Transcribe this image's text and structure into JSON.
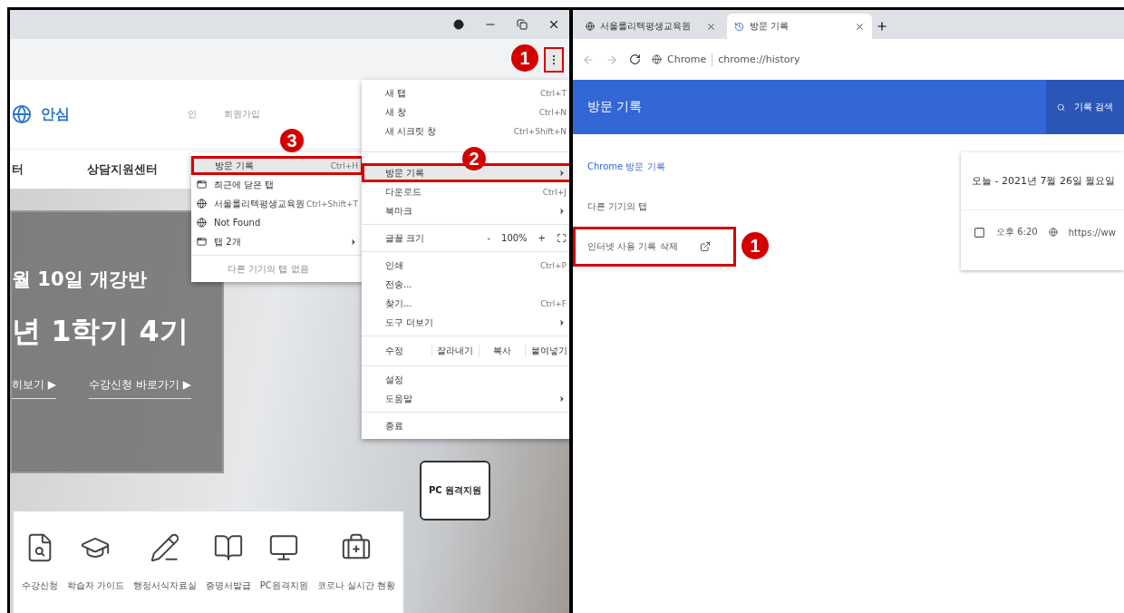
{
  "left_window": {
    "menu_badge": "1",
    "site": {
      "logo_text": "안심",
      "header_links": [
        "인",
        "회원가입"
      ],
      "nav": [
        "터",
        "상담지원센터"
      ],
      "hero": {
        "subtitle": "월 10일 개강반",
        "title": "년 1학기 4기",
        "links": [
          "히보기 ▶",
          "수강신청 바로가기 ▶"
        ]
      },
      "floating_card": "PC 원격지원",
      "quick_menu": [
        {
          "label": "수강신청",
          "kind": "apply"
        },
        {
          "label": "학습자 가이드",
          "kind": "guide"
        },
        {
          "label": "행정서식자료실",
          "kind": "forms"
        },
        {
          "label": "증명서발급",
          "kind": "certificate"
        },
        {
          "label": "PC원격지원",
          "kind": "remote"
        },
        {
          "label": "코로나 실시간 현황",
          "kind": "covid"
        }
      ]
    },
    "main_menu": [
      {
        "kind": "item",
        "label": "새 탭",
        "shortcut": "Ctrl+T"
      },
      {
        "kind": "item",
        "label": "새 창",
        "shortcut": "Ctrl+N"
      },
      {
        "kind": "item",
        "label": "새 시크릿 창",
        "shortcut": "Ctrl+Shift+N"
      },
      {
        "kind": "divider"
      },
      {
        "kind": "submenu",
        "label": "방문 기록",
        "highlighted": true,
        "badge": "2"
      },
      {
        "kind": "item",
        "label": "다운로드",
        "shortcut": "Ctrl+J"
      },
      {
        "kind": "submenu",
        "label": "북마크"
      },
      {
        "kind": "divider"
      },
      {
        "kind": "zoom",
        "label": "글꼴 크기",
        "minus": "-",
        "value": "100%",
        "plus": "+"
      },
      {
        "kind": "divider"
      },
      {
        "kind": "item",
        "label": "인쇄",
        "shortcut": "Ctrl+P"
      },
      {
        "kind": "item",
        "label": "전송..."
      },
      {
        "kind": "item",
        "label": "찾기...",
        "shortcut": "Ctrl+F"
      },
      {
        "kind": "submenu",
        "label": "도구 더보기"
      },
      {
        "kind": "divider"
      },
      {
        "kind": "edit",
        "label": "수정",
        "buttons": [
          "잘라내기",
          "복사",
          "붙여넣기"
        ]
      },
      {
        "kind": "divider"
      },
      {
        "kind": "item",
        "label": "설정"
      },
      {
        "kind": "submenu",
        "label": "도움말"
      },
      {
        "kind": "divider"
      },
      {
        "kind": "item",
        "label": "종료"
      }
    ],
    "history_submenu": [
      {
        "kind": "item",
        "label": "방문 기록",
        "shortcut": "Ctrl+H",
        "highlighted": true,
        "badge": "3"
      },
      {
        "kind": "recent_header",
        "label": "최근에 닫은 탭"
      },
      {
        "kind": "closed_page",
        "label": "서울롤리텍평생교육원",
        "shortcut": "Ctrl+Shift+T"
      },
      {
        "kind": "closed_page",
        "label": "Not Found"
      },
      {
        "kind": "tab_group",
        "label": "탭 2개"
      },
      {
        "kind": "divider"
      },
      {
        "kind": "note",
        "label": "다른 기기의 탭 없음"
      }
    ]
  },
  "right_window": {
    "tabs": [
      {
        "title": "서울롤리텍평생교육원",
        "selected": false
      },
      {
        "title": "방문 기록",
        "selected": true
      }
    ],
    "address": {
      "site_label": "Chrome",
      "url": "chrome://history"
    },
    "header": {
      "title": "방문 기록",
      "search": "기록 검색"
    },
    "sidebar": [
      {
        "label": "Chrome 방문 기록",
        "selected": true
      },
      {
        "label": "다른 기기의 탭",
        "selected": false
      },
      {
        "label": "인터넷 사용 기록 삭제",
        "selected": false,
        "external": true,
        "highlighted": true,
        "badge": "1"
      }
    ],
    "card": {
      "date": "오늘 - 2021년 7월 26일 월요일",
      "entries": [
        {
          "time": "오후 6:20",
          "url": "https://ww",
          "checked": false
        }
      ]
    }
  }
}
